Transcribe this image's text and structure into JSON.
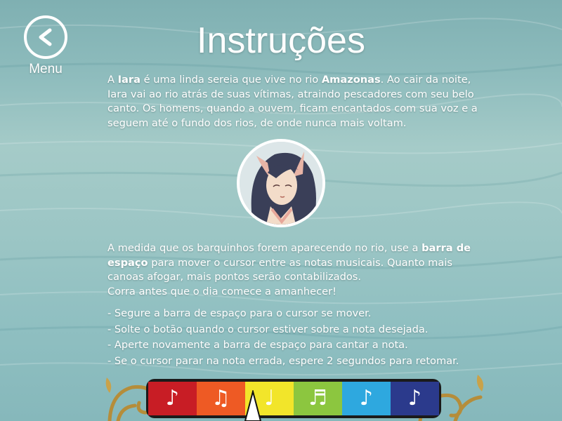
{
  "menu": {
    "label": "Menu",
    "icon": "back-chevron-icon"
  },
  "title": "Instruções",
  "intro": {
    "t1": "A ",
    "b1": "Iara",
    "t2": " é uma linda sereia que vive no rio ",
    "b2": "Amazonas",
    "t3": ". Ao cair da noite, Iara vai ao rio atrás de suas vítimas, atraindo pescadores com seu belo canto.  Os homens, quando a ouvem, ficam encantados com sua voz e a seguem até o fundo dos rios, de onde nunca mais voltam."
  },
  "portrait": {
    "icon": "iara-mermaid-portrait"
  },
  "instructions": {
    "t1": "A medida que os barquinhos forem aparecendo no rio, use a ",
    "b1": "barra de espaço",
    "t2": " para mover o cursor entre as notas musicais. Quanto mais canoas afogar, mais pontos serão contabilizados.",
    "t3": "Corra antes que o dia comece a amanhecer!"
  },
  "steps": [
    "- Segure a barra de espaço para o cursor se mover.",
    "- Solte o botão quando o cursor estiver sobre a nota desejada.",
    "- Aperte novamente a barra de espaço para cantar a nota.",
    "- Se o cursor parar na nota errada, espere 2 segundos para retomar."
  ],
  "notes": [
    {
      "icon": "quarter-note-icon",
      "glyph": "♪",
      "color": "#c81d25"
    },
    {
      "icon": "beamed-eighth-notes-icon",
      "glyph": "♫",
      "color": "#ee5a24"
    },
    {
      "icon": "half-note-icon",
      "glyph": "♩",
      "color": "#f2e52a"
    },
    {
      "icon": "beamed-sixteenth-notes-icon",
      "glyph": "♬",
      "color": "#8cc63f"
    },
    {
      "icon": "note-icon",
      "glyph": "♪",
      "color": "#2ea8df"
    },
    {
      "icon": "sixteenth-note-icon",
      "glyph": "♪",
      "color": "#2b3a8c"
    }
  ],
  "cursor": {
    "icon": "note-selector-cursor-icon",
    "selected_index": 2
  }
}
